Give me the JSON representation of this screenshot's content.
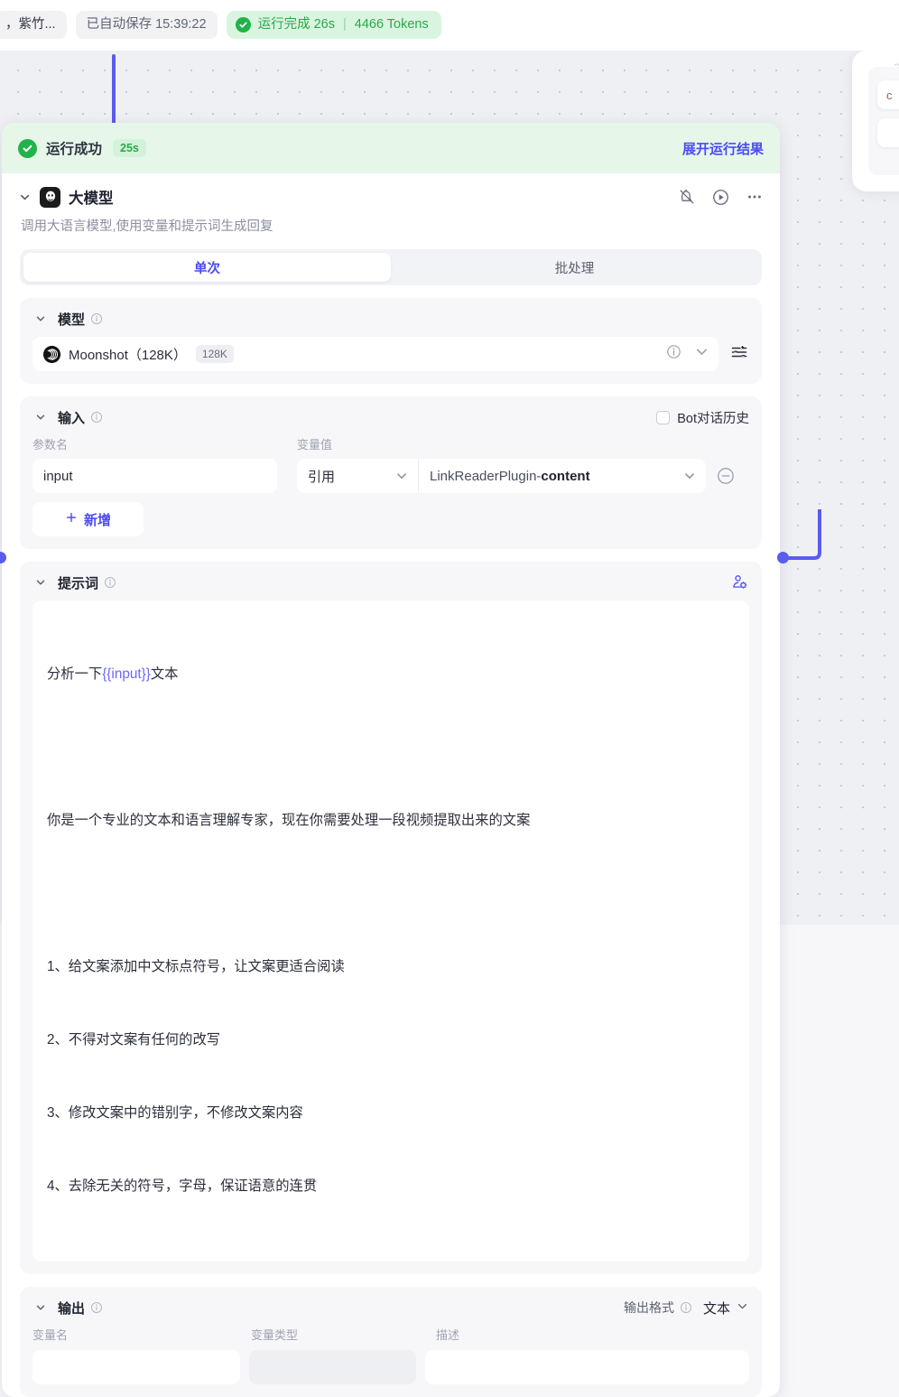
{
  "topbar": {
    "breadcrumb_truncated": "，紫竹...",
    "autosave": "已自动保存 15:39:22",
    "run_status": "运行完成 26s",
    "run_separator": "|",
    "run_tokens": "4466 Tokens"
  },
  "banner": {
    "status": "运行成功",
    "duration": "25s",
    "expand_link": "展开运行结果"
  },
  "node": {
    "title": "大模型",
    "description": "调用大语言模型,使用变量和提示词生成回复",
    "tabs": [
      {
        "label": "单次",
        "active": true
      },
      {
        "label": "批处理",
        "active": false
      }
    ]
  },
  "model_section": {
    "title": "模型",
    "selected": "Moonshot（128K）",
    "context_badge": "128K"
  },
  "input_section": {
    "title": "输入",
    "bot_history_label": "Bot对话历史",
    "bot_history_checked": false,
    "col_param": "参数名",
    "col_value": "变量值",
    "rows": [
      {
        "param": "input",
        "ref_mode": "引用",
        "var_source": "LinkReaderPlugin",
        "var_dash": " - ",
        "var_field": "content"
      }
    ],
    "add_label": "新增"
  },
  "prompt_section": {
    "title": "提示词",
    "line_1_a": "分析一下",
    "line_1_var": "{{input}}",
    "line_1_b": "文本",
    "line_2": "你是一个专业的文本和语言理解专家，现在你需要处理一段视频提取出来的文案",
    "rules": [
      "1、给文案添加中文标点符号，让文案更适合阅读",
      "2、不得对文案有任何的改写",
      "3、修改文案中的错别字，不修改文案内容",
      "4、去除无关的符号，字母，保证语意的连贯"
    ]
  },
  "output_section": {
    "title": "输出",
    "format_label": "输出格式",
    "format_value": "文本",
    "col_var_name": "变量名",
    "col_var_type": "变量类型",
    "col_desc": "描述"
  },
  "icons": {
    "check": "check-icon",
    "chevron_down": "chevron-down-icon",
    "info": "info-icon",
    "notify_off": "notification-off-icon",
    "run": "play-circle-icon",
    "more": "more-horizontal-icon",
    "sliders": "sliders-icon",
    "persona": "persona-settings-icon",
    "plus": "plus-icon",
    "minus": "minus-circle-icon"
  },
  "colors": {
    "accent": "#4b4bf5",
    "success": "#21b34a",
    "success_bg": "#e6f7ea",
    "canvas": "#eff0f4"
  }
}
